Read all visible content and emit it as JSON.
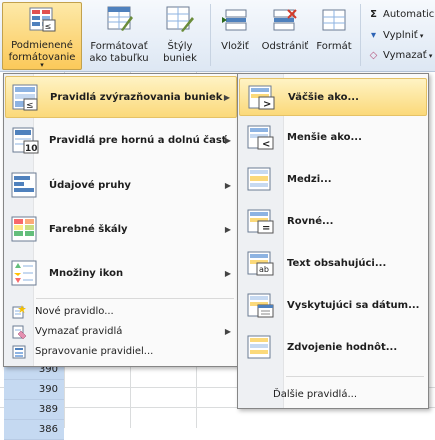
{
  "ribbon": {
    "conditional_formatting": {
      "label_line1": "Podmienené",
      "label_line2": "formátovanie"
    },
    "format_as_table": {
      "label_line1": "Formátovať",
      "label_line2": "ako tabuľku"
    },
    "cell_styles": {
      "label_line1": "Štýly",
      "label_line2": "buniek"
    },
    "insert": {
      "label": "Vložiť"
    },
    "delete": {
      "label": "Odstrániť"
    },
    "format": {
      "label": "Formát"
    },
    "autosum": {
      "label": "Automatic"
    },
    "fill": {
      "label": "Vyplniť"
    },
    "clear": {
      "label": "Vymazať"
    }
  },
  "cells": [
    "390",
    "390",
    "389",
    "386"
  ],
  "left_menu": {
    "items": [
      {
        "label": "Pravidlá zvýrazňovania buniek",
        "icon": "highlight-cells-rules-icon"
      },
      {
        "label": "Pravidlá pre hornú a dolnú časť",
        "icon": "top-bottom-rules-icon"
      },
      {
        "label": "Údajové pruhy",
        "icon": "data-bars-icon"
      },
      {
        "label": "Farebné škály",
        "icon": "color-scales-icon"
      },
      {
        "label": "Množiny ikon",
        "icon": "icon-sets-icon"
      }
    ],
    "small_items": [
      {
        "label": "Nové pravidlo...",
        "icon": "new-rule-icon"
      },
      {
        "label": "Vymazať pravidlá",
        "icon": "clear-rules-icon"
      },
      {
        "label": "Spravovanie pravidiel...",
        "icon": "manage-rules-icon"
      }
    ],
    "top_bottom_badge": "10"
  },
  "right_menu": {
    "items": [
      {
        "label": "Väčšie ako...",
        "symbol": ">"
      },
      {
        "label": "Menšie ako...",
        "symbol": "<"
      },
      {
        "label": "Medzi...",
        "symbol": ""
      },
      {
        "label": "Rovné...",
        "symbol": "="
      },
      {
        "label": "Text obsahujúci...",
        "symbol": "ab"
      },
      {
        "label": "Vyskytujúci sa dátum...",
        "symbol": ""
      },
      {
        "label": "Zdvojenie hodnôt...",
        "symbol": ""
      }
    ],
    "more_rules": "Ďalšie pravidlá..."
  },
  "colors": {
    "selection": "#fbd97a",
    "cell_selection": "#c5d9f1"
  }
}
